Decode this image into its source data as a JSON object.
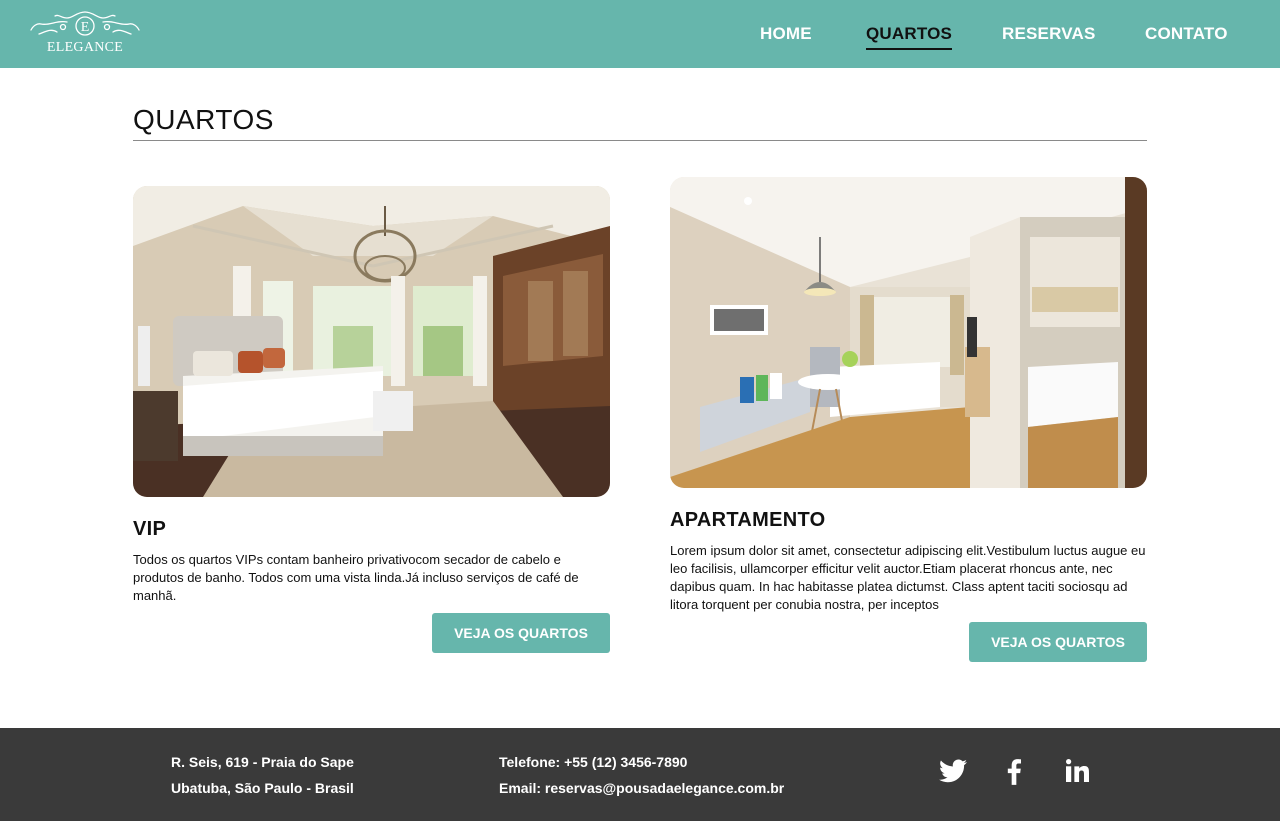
{
  "header": {
    "logo": {
      "letter": "E",
      "text": "ELEGANCE"
    },
    "nav": [
      "HOME",
      "QUARTOS",
      "RESERVAS",
      "CONTATO"
    ],
    "active_nav": "QUARTOS",
    "color": "#66b6ac"
  },
  "page": {
    "title": "QUARTOS"
  },
  "rooms": [
    {
      "title": "VIP",
      "description": "Todos os quartos VIPs contam banheiro privativocom secador de cabelo e produtos de banho. Todos com uma vista linda.Já incluso serviços de café de manhã.",
      "button": "VEJA OS QUARTOS",
      "image": "bedroom-with-chandelier-photo"
    },
    {
      "title": "APARTAMENTO",
      "description": "Lorem ipsum dolor sit amet, consectetur adipiscing elit.Vestibulum luctus augue eu leo facilisis, ullamcorper efficitur velit auctor.Etiam placerat rhoncus ante, nec dapibus quam. In hac habitasse platea dictumst. Class aptent taciti sociosqu ad litora torquent per conubia nostra, per inceptos",
      "button": "VEJA OS QUARTOS",
      "image": "modern-apartment-room-photo"
    }
  ],
  "footer": {
    "address_line1": "R. Seis, 619 - Praia do Sape",
    "address_line2": "Ubatuba, São Paulo - Brasil",
    "phone": "Telefone: +55 (12) 3456-7890",
    "email": "Email: reservas@pousadaelegance.com.br",
    "social": [
      "twitter-icon",
      "facebook-icon",
      "linkedin-icon"
    ],
    "color": "#3a3a3a"
  }
}
